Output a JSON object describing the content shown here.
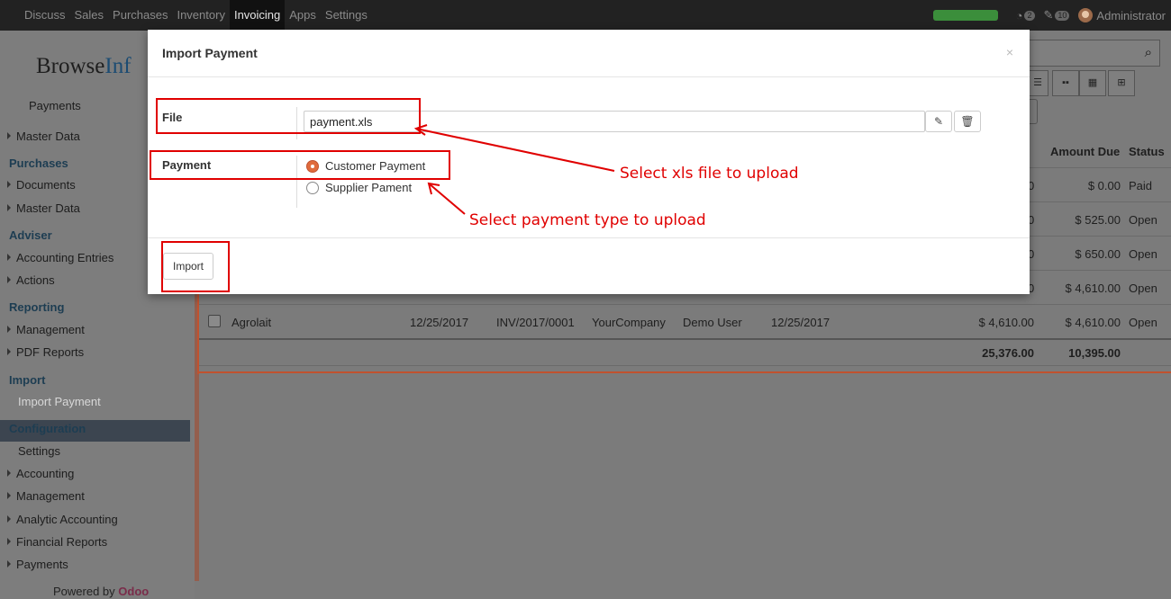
{
  "topbar": {
    "menu": [
      "Discuss",
      "Sales",
      "Purchases",
      "Inventory",
      "Invoicing",
      "Apps",
      "Settings"
    ],
    "active_menu": "Invoicing",
    "progress": 1.0,
    "chat_badge": "2",
    "message_badge": "10",
    "user": "Administrator"
  },
  "sidebar": {
    "logo_part1": "Browse",
    "logo_part2": "Inf",
    "payments": "Payments",
    "master_data_1": "Master Data",
    "purchases_head": "Purchases",
    "documents": "Documents",
    "master_data_2": "Master Data",
    "adviser_head": "Adviser",
    "accounting_entries": "Accounting Entries",
    "actions": "Actions",
    "reporting_head": "Reporting",
    "management_1": "Management",
    "pdf_reports": "PDF Reports",
    "import_head": "Import",
    "import_payment": "Import Payment",
    "configuration_head": "Configuration",
    "settings": "Settings",
    "accounting": "Accounting",
    "management_2": "Management",
    "analytic_accounting": "Analytic Accounting",
    "financial_reports": "Financial Reports",
    "payments_2": "Payments",
    "powered_by": "Powered by",
    "powered_brand": "Odoo"
  },
  "list": {
    "col_partial": "l",
    "col_amount_due": "Amount Due",
    "col_status": "Status",
    "rows": [
      {
        "lead": "0",
        "amount_due": "$ 0.00",
        "status": "Paid"
      },
      {
        "lead": "0",
        "amount_due": "$ 525.00",
        "status": "Open"
      },
      {
        "lead": "0",
        "amount_due": "$ 650.00",
        "status": "Open"
      },
      {
        "lead": "0",
        "amount_due": "$ 4,610.00",
        "status": "Open"
      }
    ],
    "full_row": {
      "customer": "Agrolait",
      "invoice_date": "12/25/2017",
      "number": "INV/2017/0001",
      "company": "YourCompany",
      "salesperson": "Demo User",
      "due_date": "12/25/2017",
      "total": "$ 4,610.00",
      "amount_due": "$ 4,610.00",
      "status": "Open"
    },
    "totals": {
      "total": "25,376.00",
      "amount_due": "10,395.00"
    }
  },
  "modal": {
    "title": "Import Payment",
    "close": "×",
    "file_label": "File",
    "file_value": "payment.xls",
    "payment_label": "Payment",
    "options": [
      "Customer Payment",
      "Supplier Pament"
    ],
    "selected_option": "Customer Payment",
    "import_button": "Import"
  },
  "annotations": {
    "file_hint": "Select xls file to upload",
    "payment_hint": "Select payment type to upload",
    "color": "#e00000"
  },
  "colors": {
    "accent": "#e06b3c",
    "topbar": "#222222",
    "overlay": "#7b7b7b"
  }
}
